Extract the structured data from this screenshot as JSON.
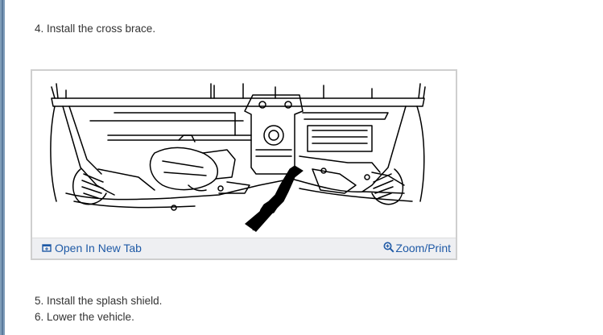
{
  "steps": {
    "step4": "4. Install the cross brace.",
    "step5": "5. Install the splash shield.",
    "step6": "6. Lower the vehicle."
  },
  "figure": {
    "image_icon": "line-drawing-of-vehicle-underside-with-arrow",
    "open_new_tab": {
      "icon": "open-new-tab-icon",
      "label": "Open In New Tab"
    },
    "zoom_print": {
      "icon": "magnifier-zoom-icon",
      "label": "Zoom/Print"
    }
  },
  "colors": {
    "link": "#1f5aa6",
    "text": "#333333",
    "footer_bg": "#eeeff2",
    "border": "#cfcfcf",
    "page_left_border": "#7f9db9"
  }
}
